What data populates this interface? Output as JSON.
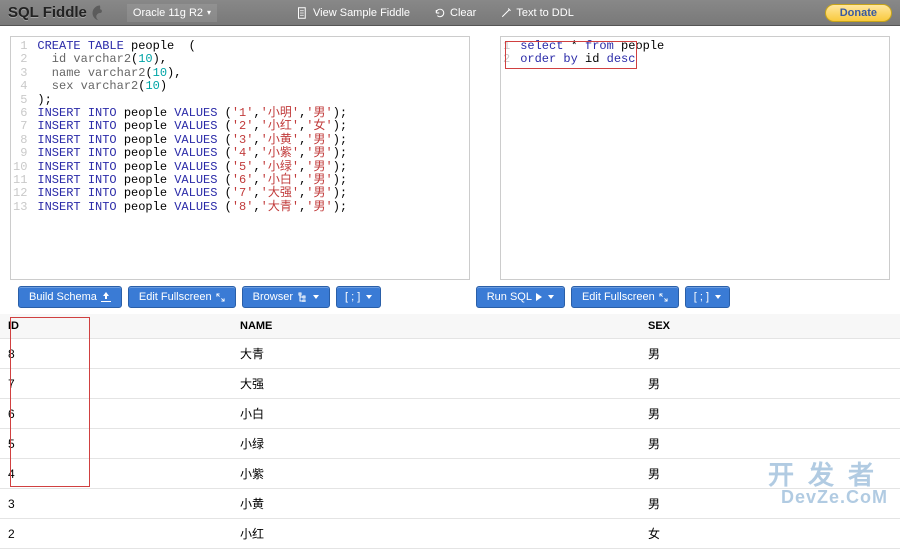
{
  "header": {
    "brand": "SQL Fiddle",
    "db_label": "Oracle 11g R2",
    "links": {
      "sample": "View Sample Fiddle",
      "clear": "Clear",
      "ddl": "Text to DDL"
    },
    "donate": "Donate"
  },
  "schema_editor": {
    "lines": [
      [
        {
          "t": "CREATE TABLE",
          "c": "kw"
        },
        {
          "t": " people  (",
          "c": "punc"
        }
      ],
      [
        {
          "t": "  id ",
          "c": "fn"
        },
        {
          "t": "varchar2",
          "c": "fn"
        },
        {
          "t": "(",
          "c": "punc"
        },
        {
          "t": "10",
          "c": "num"
        },
        {
          "t": "),",
          "c": "punc"
        }
      ],
      [
        {
          "t": "  name ",
          "c": "fn"
        },
        {
          "t": "varchar2",
          "c": "fn"
        },
        {
          "t": "(",
          "c": "punc"
        },
        {
          "t": "10",
          "c": "num"
        },
        {
          "t": "),",
          "c": "punc"
        }
      ],
      [
        {
          "t": "  sex ",
          "c": "fn"
        },
        {
          "t": "varchar2",
          "c": "fn"
        },
        {
          "t": "(",
          "c": "punc"
        },
        {
          "t": "10",
          "c": "num"
        },
        {
          "t": ")",
          "c": "punc"
        }
      ],
      [
        {
          "t": ");",
          "c": "punc"
        }
      ],
      [
        {
          "t": "INSERT INTO",
          "c": "kw"
        },
        {
          "t": " people ",
          "c": "punc"
        },
        {
          "t": "VALUES",
          "c": "kw"
        },
        {
          "t": " (",
          "c": "punc"
        },
        {
          "t": "'1'",
          "c": "str"
        },
        {
          "t": ",",
          "c": "punc"
        },
        {
          "t": "'小明'",
          "c": "str"
        },
        {
          "t": ",",
          "c": "punc"
        },
        {
          "t": "'男'",
          "c": "str"
        },
        {
          "t": ");",
          "c": "punc"
        }
      ],
      [
        {
          "t": "INSERT INTO",
          "c": "kw"
        },
        {
          "t": " people ",
          "c": "punc"
        },
        {
          "t": "VALUES",
          "c": "kw"
        },
        {
          "t": " (",
          "c": "punc"
        },
        {
          "t": "'2'",
          "c": "str"
        },
        {
          "t": ",",
          "c": "punc"
        },
        {
          "t": "'小红'",
          "c": "str"
        },
        {
          "t": ",",
          "c": "punc"
        },
        {
          "t": "'女'",
          "c": "str"
        },
        {
          "t": ");",
          "c": "punc"
        }
      ],
      [
        {
          "t": "INSERT INTO",
          "c": "kw"
        },
        {
          "t": " people ",
          "c": "punc"
        },
        {
          "t": "VALUES",
          "c": "kw"
        },
        {
          "t": " (",
          "c": "punc"
        },
        {
          "t": "'3'",
          "c": "str"
        },
        {
          "t": ",",
          "c": "punc"
        },
        {
          "t": "'小黄'",
          "c": "str"
        },
        {
          "t": ",",
          "c": "punc"
        },
        {
          "t": "'男'",
          "c": "str"
        },
        {
          "t": ");",
          "c": "punc"
        }
      ],
      [
        {
          "t": "INSERT INTO",
          "c": "kw"
        },
        {
          "t": " people ",
          "c": "punc"
        },
        {
          "t": "VALUES",
          "c": "kw"
        },
        {
          "t": " (",
          "c": "punc"
        },
        {
          "t": "'4'",
          "c": "str"
        },
        {
          "t": ",",
          "c": "punc"
        },
        {
          "t": "'小紫'",
          "c": "str"
        },
        {
          "t": ",",
          "c": "punc"
        },
        {
          "t": "'男'",
          "c": "str"
        },
        {
          "t": ");",
          "c": "punc"
        }
      ],
      [
        {
          "t": "INSERT INTO",
          "c": "kw"
        },
        {
          "t": " people ",
          "c": "punc"
        },
        {
          "t": "VALUES",
          "c": "kw"
        },
        {
          "t": " (",
          "c": "punc"
        },
        {
          "t": "'5'",
          "c": "str"
        },
        {
          "t": ",",
          "c": "punc"
        },
        {
          "t": "'小绿'",
          "c": "str"
        },
        {
          "t": ",",
          "c": "punc"
        },
        {
          "t": "'男'",
          "c": "str"
        },
        {
          "t": ");",
          "c": "punc"
        }
      ],
      [
        {
          "t": "INSERT INTO",
          "c": "kw"
        },
        {
          "t": " people ",
          "c": "punc"
        },
        {
          "t": "VALUES",
          "c": "kw"
        },
        {
          "t": " (",
          "c": "punc"
        },
        {
          "t": "'6'",
          "c": "str"
        },
        {
          "t": ",",
          "c": "punc"
        },
        {
          "t": "'小白'",
          "c": "str"
        },
        {
          "t": ",",
          "c": "punc"
        },
        {
          "t": "'男'",
          "c": "str"
        },
        {
          "t": ");",
          "c": "punc"
        }
      ],
      [
        {
          "t": "INSERT INTO",
          "c": "kw"
        },
        {
          "t": " people ",
          "c": "punc"
        },
        {
          "t": "VALUES",
          "c": "kw"
        },
        {
          "t": " (",
          "c": "punc"
        },
        {
          "t": "'7'",
          "c": "str"
        },
        {
          "t": ",",
          "c": "punc"
        },
        {
          "t": "'大强'",
          "c": "str"
        },
        {
          "t": ",",
          "c": "punc"
        },
        {
          "t": "'男'",
          "c": "str"
        },
        {
          "t": ");",
          "c": "punc"
        }
      ],
      [
        {
          "t": "INSERT INTO",
          "c": "kw"
        },
        {
          "t": " people ",
          "c": "punc"
        },
        {
          "t": "VALUES",
          "c": "kw"
        },
        {
          "t": " (",
          "c": "punc"
        },
        {
          "t": "'8'",
          "c": "str"
        },
        {
          "t": ",",
          "c": "punc"
        },
        {
          "t": "'大青'",
          "c": "str"
        },
        {
          "t": ",",
          "c": "punc"
        },
        {
          "t": "'男'",
          "c": "str"
        },
        {
          "t": ");",
          "c": "punc"
        }
      ]
    ]
  },
  "query_editor": {
    "lines": [
      [
        {
          "t": "select",
          "c": "kw"
        },
        {
          "t": " * ",
          "c": "punc"
        },
        {
          "t": "from",
          "c": "kw"
        },
        {
          "t": " people",
          "c": "punc"
        }
      ],
      [
        {
          "t": "order by",
          "c": "kw"
        },
        {
          "t": " id ",
          "c": "punc"
        },
        {
          "t": "desc",
          "c": "kw"
        }
      ]
    ]
  },
  "buttons": {
    "build_schema": "Build Schema",
    "edit_fullscreen": "Edit Fullscreen",
    "browser": "Browser",
    "terminator": "[ ; ]",
    "run_sql": "Run SQL"
  },
  "results": {
    "columns": [
      "ID",
      "NAME",
      "SEX"
    ],
    "rows": [
      {
        "id": "8",
        "name": "大青",
        "sex": "男"
      },
      {
        "id": "7",
        "name": "大强",
        "sex": "男"
      },
      {
        "id": "6",
        "name": "小白",
        "sex": "男"
      },
      {
        "id": "5",
        "name": "小绿",
        "sex": "男"
      },
      {
        "id": "4",
        "name": "小紫",
        "sex": "男"
      },
      {
        "id": "3",
        "name": "小黄",
        "sex": "男"
      },
      {
        "id": "2",
        "name": "小红",
        "sex": "女"
      }
    ]
  },
  "watermark": {
    "cn": "开发者",
    "en": "DevZe.CoM"
  }
}
